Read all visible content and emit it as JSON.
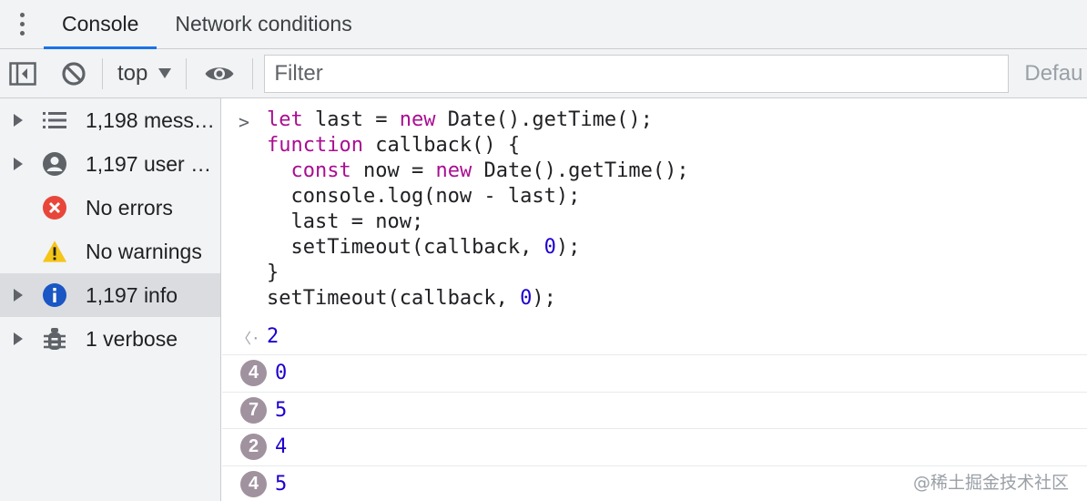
{
  "tabs": [
    {
      "label": "Console",
      "active": true
    },
    {
      "label": "Network conditions",
      "active": false
    }
  ],
  "toolbar": {
    "context": "top",
    "filter_placeholder": "Filter",
    "levels_label": "Defau"
  },
  "sidebar": {
    "items": [
      {
        "label": "1,198 messages",
        "icon": "list-icon",
        "expandable": true
      },
      {
        "label": "1,197 user messages",
        "icon": "user-icon",
        "expandable": true
      },
      {
        "label": "No errors",
        "icon": "error-icon",
        "expandable": false
      },
      {
        "label": "No warnings",
        "icon": "warning-icon",
        "expandable": false
      },
      {
        "label": "1,197 info",
        "icon": "info-icon",
        "expandable": true,
        "selected": true
      },
      {
        "label": "1 verbose",
        "icon": "bug-icon",
        "expandable": true
      }
    ]
  },
  "console": {
    "code": {
      "l1": {
        "kw1": "let",
        "a": " last = ",
        "kw2": "new",
        "b": " Date().getTime();"
      },
      "l2": {
        "kw": "function",
        "a": " callback() {"
      },
      "l3": {
        "indent": "  ",
        "kw1": "const",
        "a": " now = ",
        "kw2": "new",
        "b": " Date().getTime();"
      },
      "l4": "  console.log(now - last);",
      "l5": "  last = now;",
      "l6": {
        "a": "  setTimeout(callback, ",
        "num": "0",
        "b": ");"
      },
      "l7": "}",
      "l8": {
        "a": "setTimeout(callback, ",
        "num": "0",
        "b": ");"
      }
    },
    "result": "2",
    "logs": [
      {
        "count": "4",
        "value": "0"
      },
      {
        "count": "7",
        "value": "5"
      },
      {
        "count": "2",
        "value": "4"
      },
      {
        "count": "4",
        "value": "5"
      }
    ]
  },
  "watermark": "@稀土掘金技术社区",
  "colors": {
    "accent": "#1a73e8",
    "keyword": "#aa0d91",
    "number": "#1c00cf",
    "badge": "#a0929f"
  }
}
